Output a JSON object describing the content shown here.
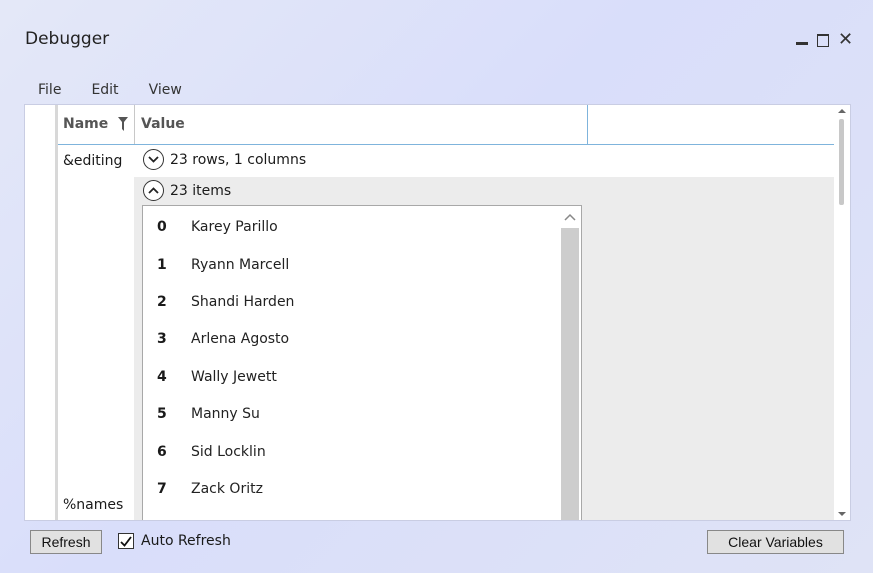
{
  "window": {
    "title": "Debugger"
  },
  "menu": {
    "items": [
      {
        "label": "File"
      },
      {
        "label": "Edit"
      },
      {
        "label": "View"
      }
    ]
  },
  "grid": {
    "headers": {
      "name": "Name",
      "value": "Value"
    },
    "rows": [
      {
        "name": "&editing",
        "summary": "23 rows, 1 columns",
        "items_summary": "23 items"
      },
      {
        "name": "%names"
      }
    ],
    "list": [
      {
        "index": "0",
        "value": "Karey Parillo"
      },
      {
        "index": "1",
        "value": "Ryann Marcell"
      },
      {
        "index": "2",
        "value": "Shandi Harden"
      },
      {
        "index": "3",
        "value": "Arlena Agosto"
      },
      {
        "index": "4",
        "value": "Wally Jewett"
      },
      {
        "index": "5",
        "value": "Manny Su"
      },
      {
        "index": "6",
        "value": "Sid Locklin"
      },
      {
        "index": "7",
        "value": "Zack Oritz"
      }
    ]
  },
  "footer": {
    "refresh_label": "Refresh",
    "auto_refresh_label": "Auto Refresh",
    "auto_refresh_checked": true,
    "clear_label": "Clear Variables"
  }
}
